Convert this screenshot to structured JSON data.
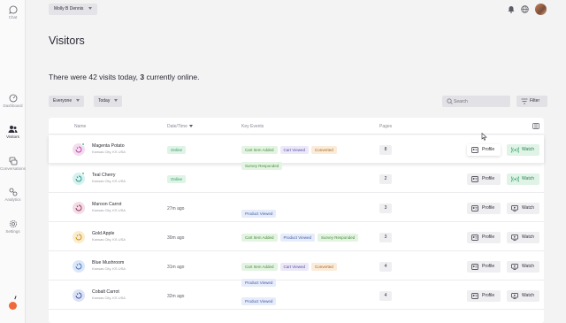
{
  "sidebar": {
    "items": [
      {
        "label": "Chat",
        "icon": "chat-bubble-icon"
      },
      {
        "label": "Dashboard",
        "icon": "gauge-icon"
      },
      {
        "label": "Visitors",
        "icon": "users-icon",
        "active": true
      },
      {
        "label": "Conversations",
        "icon": "conversations-icon"
      },
      {
        "label": "Analytics",
        "icon": "analytics-icon"
      },
      {
        "label": "Settings",
        "icon": "gear-icon"
      }
    ],
    "status_color": "#ef6a3a"
  },
  "header": {
    "account_label": "Molly B Dennis"
  },
  "page": {
    "title": "Visitors",
    "summary_prefix": "There were 42 visits today,",
    "summary_online": "3",
    "summary_suffix": "currently online."
  },
  "filters": {
    "segment": "Everyone",
    "range": "Today",
    "search_placeholder": "Search",
    "filter_label": "Filter"
  },
  "table": {
    "columns": {
      "name": "Name",
      "datetime": "Date/Time",
      "events": "Key Events",
      "pages": "Pages"
    },
    "rows": [
      {
        "name": "Magenta Potato",
        "location": "Kansas City, KS USA",
        "online": true,
        "status": "Online",
        "time": "",
        "pages": "8",
        "watch_live": true,
        "icon_color": "#f4dcf0",
        "icon_stroke": "#b0399a",
        "events": [
          {
            "label": "Cart Item Added",
            "kind": "green"
          },
          {
            "label": "Cart Viewed",
            "kind": "purple"
          },
          {
            "label": "Converted",
            "kind": "orange"
          },
          {
            "label": "Survey Responded",
            "kind": "green"
          }
        ]
      },
      {
        "name": "Teal Cherry",
        "location": "Kansas City, KS USA",
        "online": true,
        "status": "Online",
        "time": "",
        "pages": "2",
        "watch_live": true,
        "icon_color": "#d7f1ef",
        "icon_stroke": "#1c8f88",
        "events": []
      },
      {
        "name": "Maroon Carrot",
        "location": "Kansas City, KS USA",
        "online": false,
        "status": "",
        "time": "27m ago",
        "pages": "3",
        "watch_live": false,
        "icon_color": "#f4dce6",
        "icon_stroke": "#8c2a52",
        "events": [
          {
            "label": "Product Viewed",
            "kind": "blue"
          }
        ]
      },
      {
        "name": "Gold Apple",
        "location": "Kansas City, KS USA",
        "online": false,
        "status": "",
        "time": "30m ago",
        "pages": "3",
        "watch_live": false,
        "icon_color": "#fbeccc",
        "icon_stroke": "#c48a12",
        "events": [
          {
            "label": "Cart Item Added",
            "kind": "green"
          },
          {
            "label": "Product Viewed",
            "kind": "blue"
          },
          {
            "label": "Survey Responded",
            "kind": "green"
          }
        ]
      },
      {
        "name": "Blue Mushroom",
        "location": "Kansas City, KS USA",
        "online": false,
        "status": "",
        "time": "31m ago",
        "pages": "4",
        "watch_live": false,
        "icon_color": "#dbe7f8",
        "icon_stroke": "#3a6ab8",
        "events": [
          {
            "label": "Cart Item Added",
            "kind": "green"
          },
          {
            "label": "Cart Viewed",
            "kind": "purple"
          },
          {
            "label": "Converted",
            "kind": "orange"
          },
          {
            "label": "Product Viewed",
            "kind": "blue"
          }
        ]
      },
      {
        "name": "Cobalt Carrot",
        "location": "Kansas City, KS USA",
        "online": false,
        "status": "",
        "time": "32m ago",
        "pages": "4",
        "watch_live": false,
        "icon_color": "#dde3f6",
        "icon_stroke": "#304a9a",
        "events": [
          {
            "label": "Product Viewed",
            "kind": "blue"
          }
        ]
      }
    ],
    "profile_label": "Profile",
    "watch_label": "Watch"
  }
}
